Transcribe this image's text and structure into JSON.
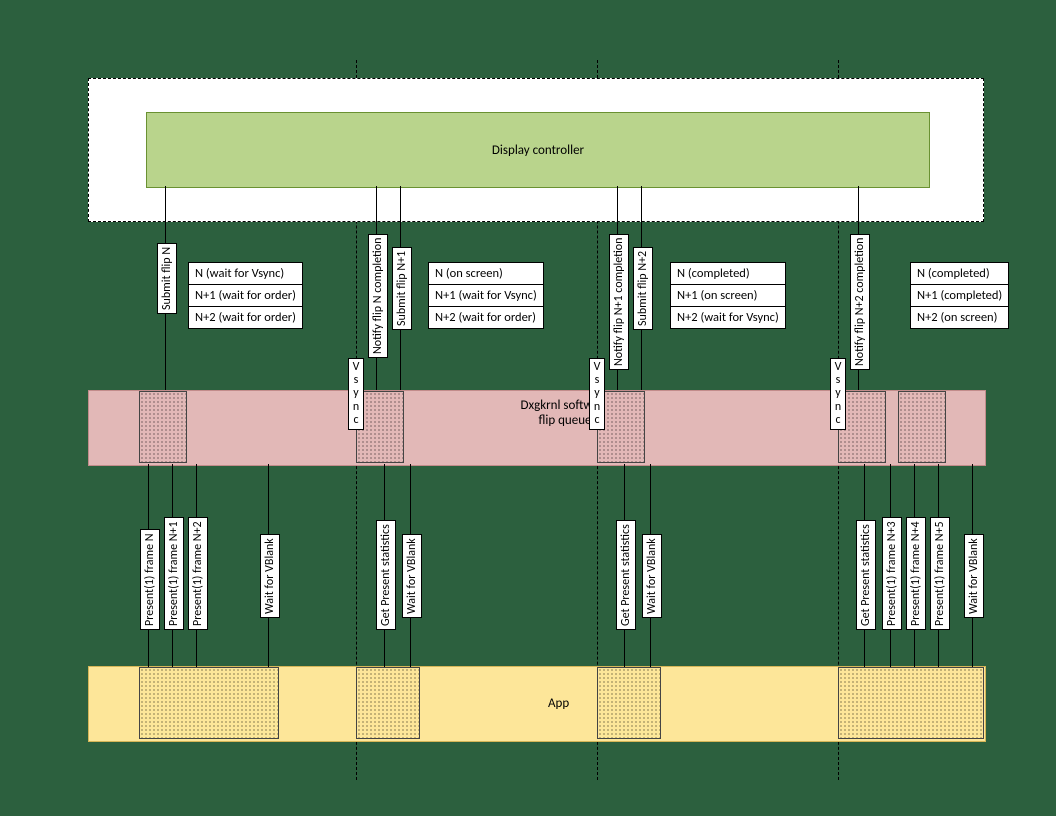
{
  "lanes": {
    "display": "Display controller",
    "dxg": "Dxgkrnl software flip queue",
    "app": "App",
    "vsync": "V\ns\ny\nn\nc"
  },
  "states": {
    "c0": {
      "r0": "N (wait for Vsync)",
      "r1": "N+1 (wait for order)",
      "r2": "N+2 (wait for order)"
    },
    "c1": {
      "r0": "N (on screen)",
      "r1": "N+1 (wait for Vsync)",
      "r2": "N+2 (wait for order)"
    },
    "c2": {
      "r0": "N (completed)",
      "r1": "N+1 (on screen)",
      "r2": "N+2 (wait for Vsync)"
    },
    "c3": {
      "r0": "N (completed)",
      "r1": "N+1 (completed)",
      "r2": "N+2 (on screen)"
    }
  },
  "arrows": {
    "submitN": "Submit flip N",
    "submitN1": "Submit flip N+1",
    "submitN2": "Submit flip N+2",
    "compN": "Notify flip N completion",
    "compN1": "Notify flip N+1 completion",
    "compN2": "Notify flip N+2 completion",
    "presN": "Present(1) frame N",
    "presN1": "Present(1) frame N+1",
    "presN2": "Present(1) frame N+2",
    "presN3": "Present(1) frame N+3",
    "presN4": "Present(1) frame N+4",
    "presN5": "Present(1) frame N+5",
    "waitVB": "Wait for VBlank",
    "getStats": "Get Present statistics"
  }
}
